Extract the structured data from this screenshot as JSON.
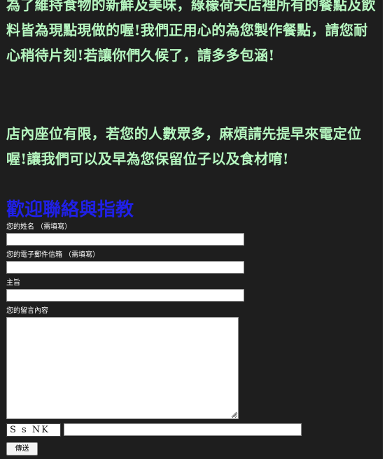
{
  "intro": {
    "paragraph1": "為了維持食物的新鮮及美味，綠檬荷夫店裡所有的餐點及飲料皆為現點現做的喔!我們正用心的為您製作餐點，請您耐心稍待片刻!若讓你們久候了，請多多包涵!",
    "paragraph2": "店內座位有限，若您的人數眾多，麻煩請先提早來電定位喔!讓我們可以及早為您保留位子以及食材唷!"
  },
  "contact_form": {
    "heading": "歡迎聯絡與指教",
    "name_label": "您的姓名 （需填寫）",
    "name_value": "",
    "email_label": "您的電子郵件信箱 （需填寫）",
    "email_value": "",
    "subject_label": "主旨",
    "subject_value": "",
    "message_label": "您的留言內容",
    "message_value": "",
    "captcha_text": "S s NK",
    "captcha_value": "",
    "submit_label": "傳送"
  },
  "colors": {
    "background": "#1e1e1e",
    "intro_text": "#b6f7c0",
    "heading": "#2020e6"
  }
}
